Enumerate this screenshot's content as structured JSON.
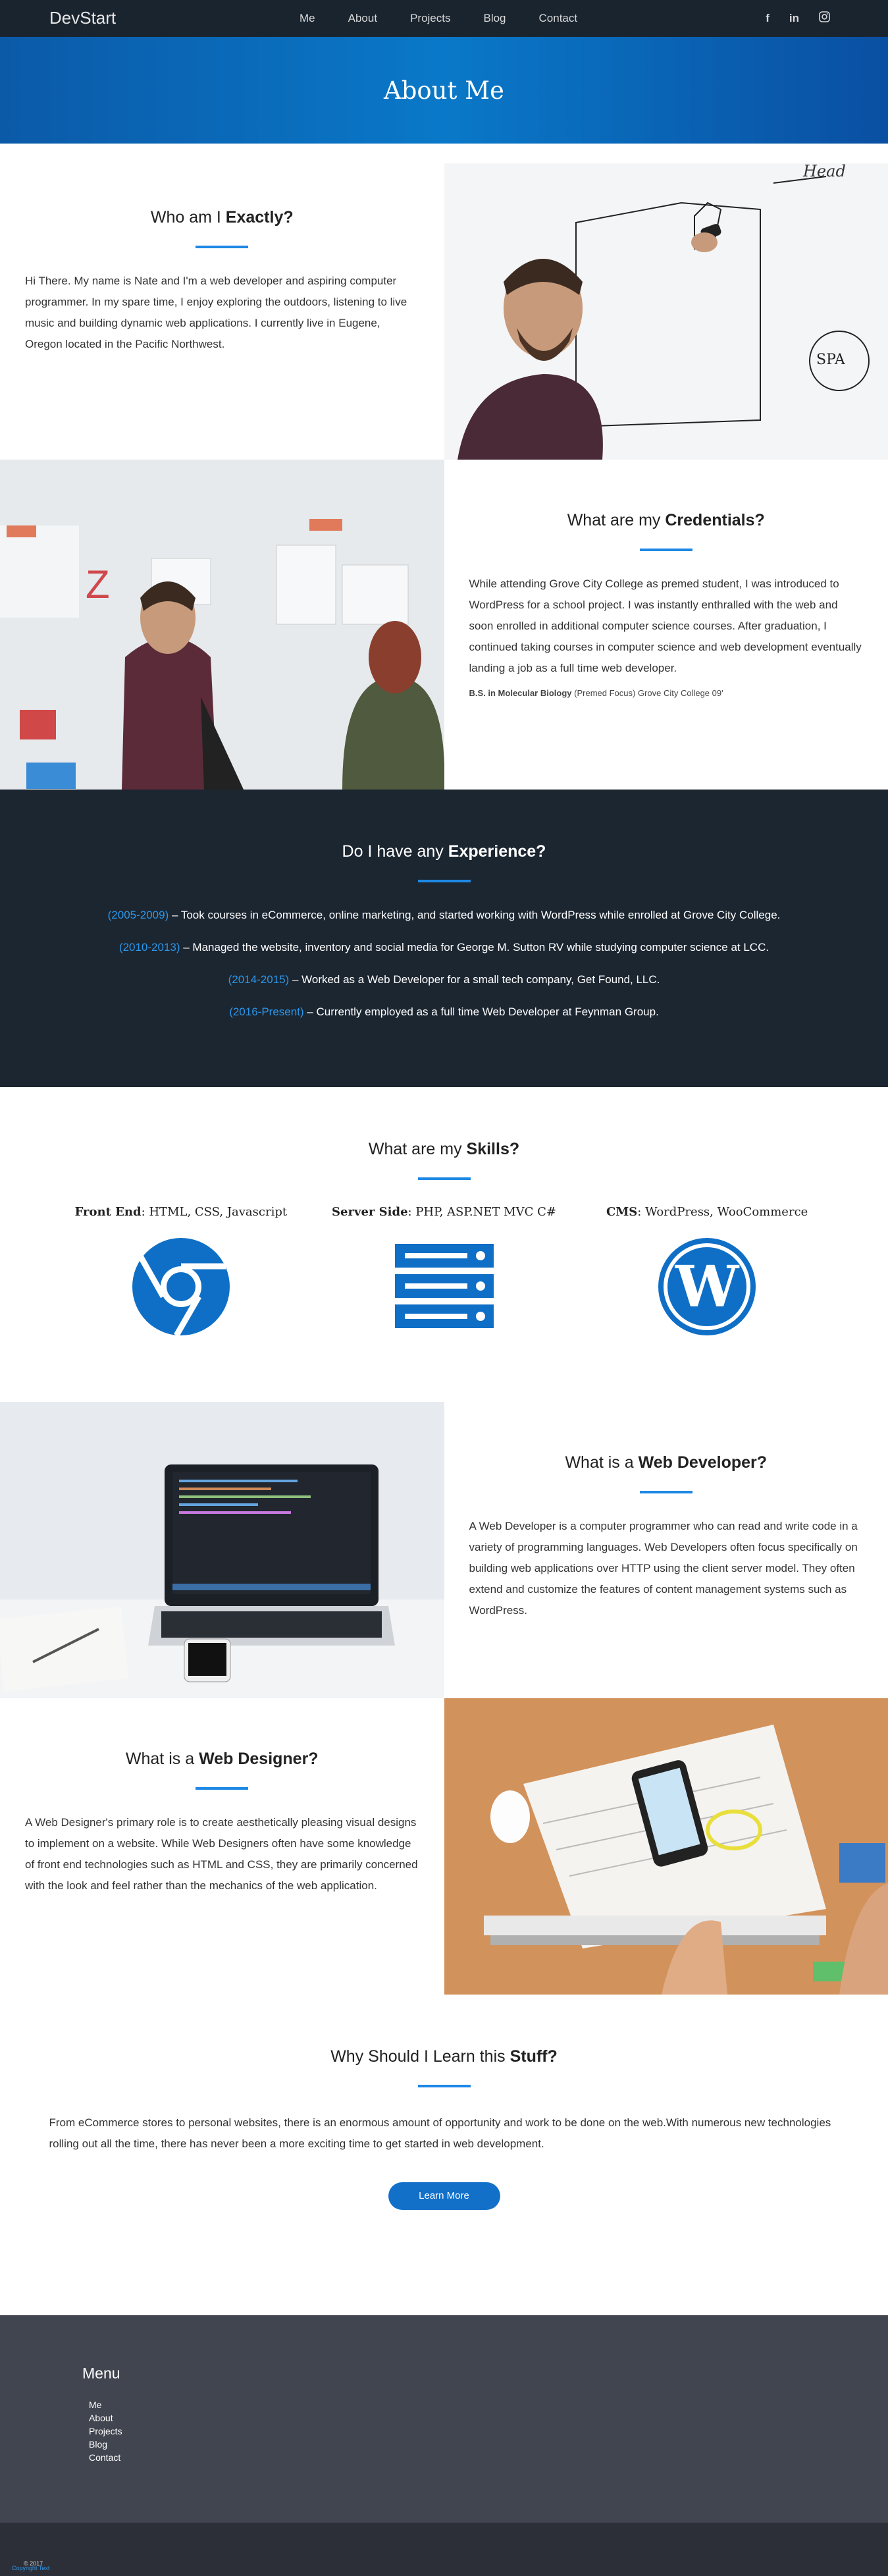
{
  "nav": {
    "brand": "DevStart",
    "links": [
      "Me",
      "About",
      "Projects",
      "Blog",
      "Contact"
    ],
    "social": [
      "facebook-icon",
      "linkedin-icon",
      "instagram-icon"
    ]
  },
  "banner": {
    "title": "About Me"
  },
  "who": {
    "heading_pre": "Who am I ",
    "heading_bold": "Exactly?",
    "body": "Hi There. My name is Nate and I'm a web developer and aspiring computer programmer. In my spare time, I enjoy exploring the outdoors, listening to live music and building dynamic web applications. I currently live in Eugene, Oregon located in the Pacific Northwest."
  },
  "credentials": {
    "heading_pre": "What are my ",
    "heading_bold": "Credentials?",
    "body": "While attending Grove City College as premed student, I was introduced to WordPress for a school project. I was instantly enthralled with the web and soon enrolled in additional computer science courses. After graduation, I continued taking courses in computer science and web development eventually landing a job as a full time web developer.",
    "degree_bold": "B.S. in Molecular Biology",
    "degree_rest": " (Premed Focus) Grove City College 09'"
  },
  "experience": {
    "heading_pre": "Do I have any ",
    "heading_bold": "Experience?",
    "items": [
      {
        "years": "(2005-2009)",
        "text": " – Took courses in eCommerce, online marketing, and started working with WordPress while enrolled at Grove City College."
      },
      {
        "years": "(2010-2013)",
        "text": " – Managed the website, inventory and social media for George M. Sutton RV while studying computer science at LCC."
      },
      {
        "years": "(2014-2015)",
        "text": " – Worked as a Web Developer for a small tech company, Get Found, LLC."
      },
      {
        "years": "(2016-Present)",
        "text": " – Currently employed as a full time Web Developer at Feynman Group."
      }
    ]
  },
  "skills": {
    "heading_pre": "What are my ",
    "heading_bold": "Skills?",
    "cols": [
      {
        "label": "Front End",
        "value": ": HTML, CSS, Javascript",
        "icon": "chrome-icon"
      },
      {
        "label": "Server Side",
        "value": ": PHP, ASP.NET MVC C#",
        "icon": "server-icon"
      },
      {
        "label": "CMS",
        "value": ": WordPress, WooCommerce",
        "icon": "wordpress-icon"
      }
    ],
    "accent": "#0f6fc6"
  },
  "developer": {
    "heading_pre": "What is a ",
    "heading_bold": "Web Developer?",
    "body": "A Web Developer is a computer programmer who can read and write code in a variety of programming languages. Web Developers often focus specifically on building web applications over HTTP using the client server model. They often extend and customize the features of content management systems such as WordPress."
  },
  "designer": {
    "heading_pre": "What is a ",
    "heading_bold": "Web Designer?",
    "body": "A Web Designer's primary role is to create aesthetically pleasing visual designs to implement on a website. While Web Designers often have some knowledge of front end technologies such as HTML and CSS, they are primarily concerned with the look and feel rather than the mechanics of the web application."
  },
  "why": {
    "heading_pre": "Why Should I Learn this ",
    "heading_bold": "Stuff?",
    "body": "From eCommerce stores to personal websites, there is an enormous amount of opportunity and work to be done on the web.With numerous new technologies rolling out all the time, there has never been a more exciting time to get started in web development.",
    "button": "Learn More"
  },
  "footer": {
    "title": "Menu",
    "links": [
      "Me",
      "About",
      "Projects",
      "Blog",
      "Contact"
    ],
    "copy_pre": "© 2017 ",
    "copy_link": "Copyright Text"
  }
}
